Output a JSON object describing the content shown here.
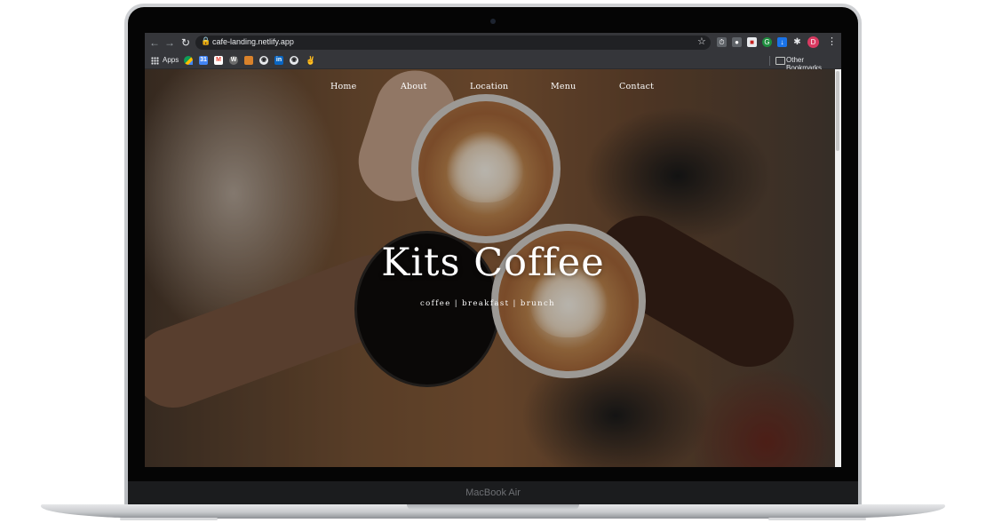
{
  "browser": {
    "url": "cafe-landing.netlify.app",
    "bookmarks_bar": {
      "apps_label": "Apps",
      "other_bookmarks_label": "Other Bookmarks"
    },
    "profile_initial": "D",
    "icons": [
      "back-arrow-icon",
      "forward-arrow-icon",
      "reload-icon",
      "lock-icon",
      "bookmark-star-icon",
      "extensions-puzzle-icon",
      "menu-kebab-icon"
    ]
  },
  "site": {
    "nav": [
      "Home",
      "About",
      "Location",
      "Menu",
      "Contact"
    ],
    "hero": {
      "title": "Kits Coffee",
      "tagline": "coffee | breakfast | brunch"
    }
  },
  "device": {
    "model": "MacBook Air"
  }
}
